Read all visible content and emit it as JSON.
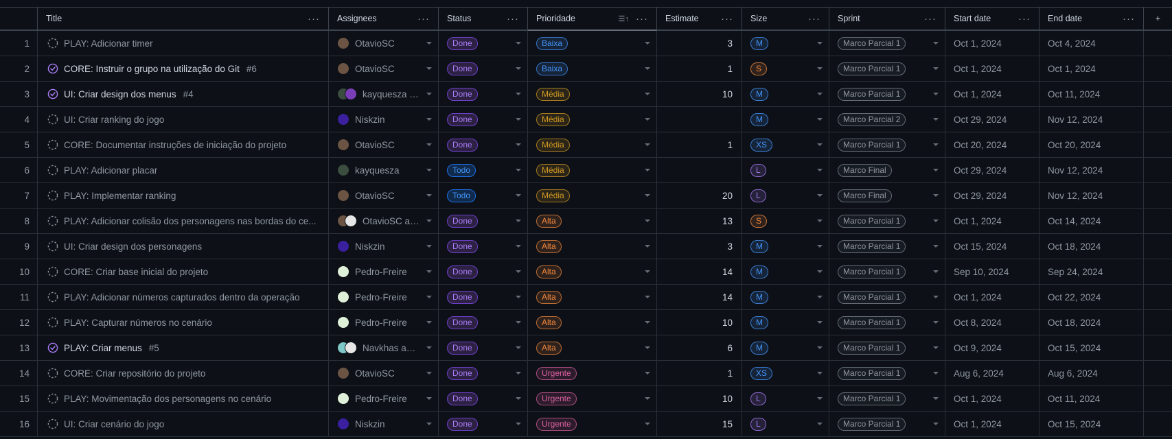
{
  "columns": {
    "title": "Title",
    "assignees": "Assignees",
    "status": "Status",
    "prioridade": "Prioridade",
    "estimate": "Estimate",
    "size": "Size",
    "sprint": "Sprint",
    "start_date": "Start date",
    "end_date": "End date"
  },
  "icons": {
    "column_menu": "more-horizontal-icon",
    "sort": "sort-ascending-icon",
    "add_field": "plus-icon"
  },
  "colors": {
    "done_fg": "#ab7df8",
    "done_bg": "#2c2143",
    "done_border": "#6e40c9",
    "todo_fg": "#4493f8",
    "todo_bg": "#0f2a4a",
    "todo_border": "#1f6feb",
    "baixa": "#4493f8",
    "media": "#d29922",
    "alta": "#f0883e",
    "urgente": "#db61a2",
    "size_m": "#4493f8",
    "size_s": "#f0883e",
    "size_xs": "#4493f8",
    "size_l": "#ab7df8"
  },
  "rows": [
    {
      "num": "1",
      "title": "PLAY: Adicionar timer",
      "state": "draft",
      "issue": "",
      "assignees": "OtavioSC",
      "avatars": [
        "#6b5443"
      ],
      "status": "Done",
      "priority": "Baixa",
      "estimate": "3",
      "size": "M",
      "sprint": "Marco Parcial 1",
      "start": "Oct 1, 2024",
      "end": "Oct 4, 2024"
    },
    {
      "num": "2",
      "title": "CORE: Instruir o grupo na utilização do Git",
      "state": "closed",
      "issue": "#6",
      "assignees": "OtavioSC",
      "avatars": [
        "#6b5443"
      ],
      "status": "Done",
      "priority": "Baixa",
      "estimate": "1",
      "size": "S",
      "sprint": "Marco Parcial 1",
      "start": "Oct 1, 2024",
      "end": "Oct 1, 2024"
    },
    {
      "num": "3",
      "title": "UI: Criar design dos menus",
      "state": "closed",
      "issue": "#4",
      "assignees": "kayquesza an...",
      "avatars": [
        "#3b4d3f",
        "#7a3fb8"
      ],
      "status": "Done",
      "priority": "Média",
      "estimate": "10",
      "size": "M",
      "sprint": "Marco Parcial 1",
      "start": "Oct 1, 2024",
      "end": "Oct 11, 2024"
    },
    {
      "num": "4",
      "title": "UI: Criar ranking do jogo",
      "state": "draft",
      "issue": "",
      "assignees": "Niskzin",
      "avatars": [
        "#3a1f9e"
      ],
      "status": "Done",
      "priority": "Média",
      "estimate": "",
      "size": "M",
      "sprint": "Marco Parcial 2",
      "start": "Oct 29, 2024",
      "end": "Nov 12, 2024"
    },
    {
      "num": "5",
      "title": "CORE: Documentar instruções de iniciação do projeto",
      "state": "draft",
      "issue": "",
      "assignees": "OtavioSC",
      "avatars": [
        "#6b5443"
      ],
      "status": "Done",
      "priority": "Média",
      "estimate": "1",
      "size": "XS",
      "sprint": "Marco Parcial 1",
      "start": "Oct 20, 2024",
      "end": "Oct 20, 2024"
    },
    {
      "num": "6",
      "title": "PLAY: Adicionar placar",
      "state": "draft",
      "issue": "",
      "assignees": "kayquesza",
      "avatars": [
        "#3b4d3f"
      ],
      "status": "Todo",
      "priority": "Média",
      "estimate": "",
      "size": "L",
      "sprint": "Marco Final",
      "start": "Oct 29, 2024",
      "end": "Nov 12, 2024"
    },
    {
      "num": "7",
      "title": "PLAY: Implementar ranking",
      "state": "draft",
      "issue": "",
      "assignees": "OtavioSC",
      "avatars": [
        "#6b5443"
      ],
      "status": "Todo",
      "priority": "Média",
      "estimate": "20",
      "size": "L",
      "sprint": "Marco Final",
      "start": "Oct 29, 2024",
      "end": "Nov 12, 2024"
    },
    {
      "num": "8",
      "title": "PLAY: Adicionar colisão dos personagens nas bordas do ce...",
      "state": "draft",
      "issue": "",
      "assignees": "OtavioSC an...",
      "avatars": [
        "#6b5443",
        "#e6e6e6"
      ],
      "status": "Done",
      "priority": "Alta",
      "estimate": "13",
      "size": "S",
      "sprint": "Marco Parcial 1",
      "start": "Oct 1, 2024",
      "end": "Oct 14, 2024"
    },
    {
      "num": "9",
      "title": "UI: Criar design dos personagens",
      "state": "draft",
      "issue": "",
      "assignees": "Niskzin",
      "avatars": [
        "#3a1f9e"
      ],
      "status": "Done",
      "priority": "Alta",
      "estimate": "3",
      "size": "M",
      "sprint": "Marco Parcial 1",
      "start": "Oct 15, 2024",
      "end": "Oct 18, 2024"
    },
    {
      "num": "10",
      "title": "CORE: Criar base inicial do projeto",
      "state": "draft",
      "issue": "",
      "assignees": "Pedro-Freire",
      "avatars": [
        "#dff0d8"
      ],
      "status": "Done",
      "priority": "Alta",
      "estimate": "14",
      "size": "M",
      "sprint": "Marco Parcial 1",
      "start": "Sep 10, 2024",
      "end": "Sep 24, 2024"
    },
    {
      "num": "11",
      "title": "PLAY: Adicionar números capturados dentro da operação",
      "state": "draft",
      "issue": "",
      "assignees": "Pedro-Freire",
      "avatars": [
        "#dff0d8"
      ],
      "status": "Done",
      "priority": "Alta",
      "estimate": "14",
      "size": "M",
      "sprint": "Marco Parcial 1",
      "start": "Oct 1, 2024",
      "end": "Oct 22, 2024"
    },
    {
      "num": "12",
      "title": "PLAY: Capturar números no cenário",
      "state": "draft",
      "issue": "",
      "assignees": "Pedro-Freire",
      "avatars": [
        "#dff0d8"
      ],
      "status": "Done",
      "priority": "Alta",
      "estimate": "10",
      "size": "M",
      "sprint": "Marco Parcial 1",
      "start": "Oct 8, 2024",
      "end": "Oct 18, 2024"
    },
    {
      "num": "13",
      "title": "PLAY: Criar menus",
      "state": "closed",
      "issue": "#5",
      "assignees": "Navkhas and ...",
      "avatars": [
        "#7fc8c8",
        "#e6e6e6"
      ],
      "status": "Done",
      "priority": "Alta",
      "estimate": "6",
      "size": "M",
      "sprint": "Marco Parcial 1",
      "start": "Oct 9, 2024",
      "end": "Oct 15, 2024"
    },
    {
      "num": "14",
      "title": "CORE: Criar repositório do projeto",
      "state": "draft",
      "issue": "",
      "assignees": "OtavioSC",
      "avatars": [
        "#6b5443"
      ],
      "status": "Done",
      "priority": "Urgente",
      "estimate": "1",
      "size": "XS",
      "sprint": "Marco Parcial 1",
      "start": "Aug 6, 2024",
      "end": "Aug 6, 2024"
    },
    {
      "num": "15",
      "title": "PLAY: Movimentação dos personagens no cenário",
      "state": "draft",
      "issue": "",
      "assignees": "Pedro-Freire",
      "avatars": [
        "#dff0d8"
      ],
      "status": "Done",
      "priority": "Urgente",
      "estimate": "10",
      "size": "L",
      "sprint": "Marco Parcial 1",
      "start": "Oct 1, 2024",
      "end": "Oct 11, 2024"
    },
    {
      "num": "16",
      "title": "UI: Criar cenário do jogo",
      "state": "draft",
      "issue": "",
      "assignees": "Niskzin",
      "avatars": [
        "#3a1f9e"
      ],
      "status": "Done",
      "priority": "Urgente",
      "estimate": "15",
      "size": "L",
      "sprint": "Marco Parcial 1",
      "start": "Oct 1, 2024",
      "end": "Oct 15, 2024"
    }
  ]
}
